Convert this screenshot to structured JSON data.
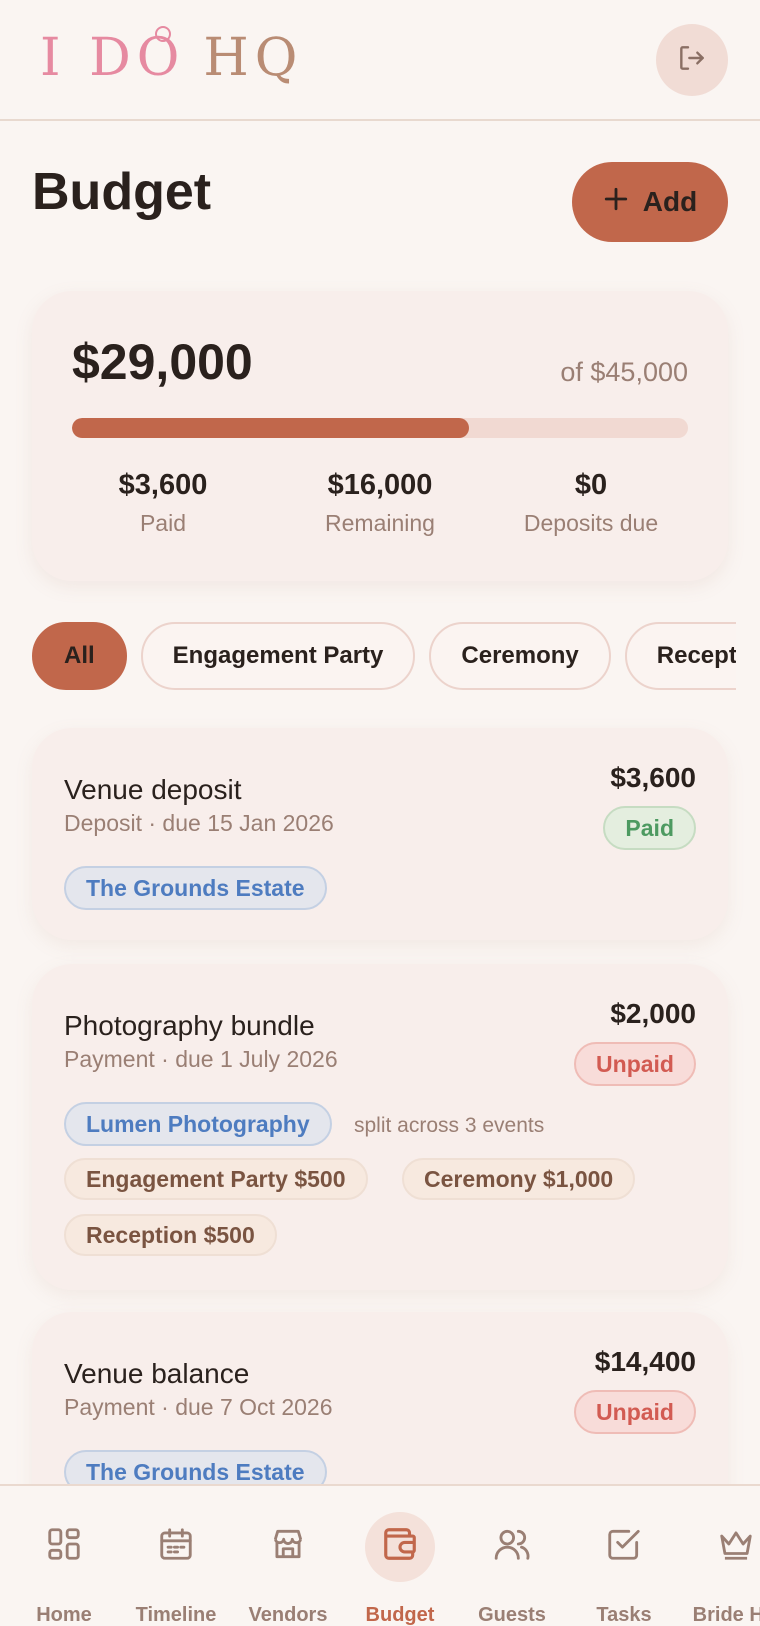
{
  "app": {
    "logo_pink": "I DO",
    "logo_tan": "HQ"
  },
  "header": {
    "title": "Budget",
    "add_label": "Add"
  },
  "summary": {
    "spent": "$29,000",
    "total": "of $45,000",
    "progress_fraction": 0.644,
    "stats": [
      {
        "value": "$3,600",
        "label": "Paid"
      },
      {
        "value": "$16,000",
        "label": "Remaining"
      },
      {
        "value": "$0",
        "label": "Deposits due"
      }
    ]
  },
  "filters": [
    "All",
    "Engagement Party",
    "Ceremony",
    "Reception"
  ],
  "active_filter": "All",
  "expenses": [
    {
      "title": "Venue deposit",
      "meta": "Deposit · due 15 Jan 2026",
      "amount": "$3,600",
      "status": "Paid",
      "vendor": "The Grounds Estate"
    },
    {
      "title": "Photography bundle",
      "meta": "Payment · due 1 July 2026",
      "amount": "$2,000",
      "status": "Unpaid",
      "vendor": "Lumen Photography",
      "split_note": "split across 3 events",
      "allocations": [
        "Engagement Party $500",
        "Ceremony $1,000",
        "Reception $500"
      ]
    },
    {
      "title": "Venue balance",
      "meta": "Payment · due 7 Oct 2026",
      "amount": "$14,400",
      "status": "Unpaid",
      "vendor": "The Grounds Estate"
    }
  ],
  "nav": [
    {
      "label": "Home",
      "icon": "grid-icon"
    },
    {
      "label": "Timeline",
      "icon": "calendar-icon"
    },
    {
      "label": "Vendors",
      "icon": "store-icon"
    },
    {
      "label": "Budget",
      "icon": "wallet-icon",
      "active": true
    },
    {
      "label": "Guests",
      "icon": "users-icon"
    },
    {
      "label": "Tasks",
      "icon": "checkbox-icon"
    },
    {
      "label": "Bride HQ",
      "icon": "crown-icon"
    }
  ],
  "colors": {
    "accent": "#c1674b",
    "background": "#faf5f2",
    "paid": "#4d9a61",
    "unpaid": "#d25b52",
    "vendor": "#4e7cc0"
  }
}
